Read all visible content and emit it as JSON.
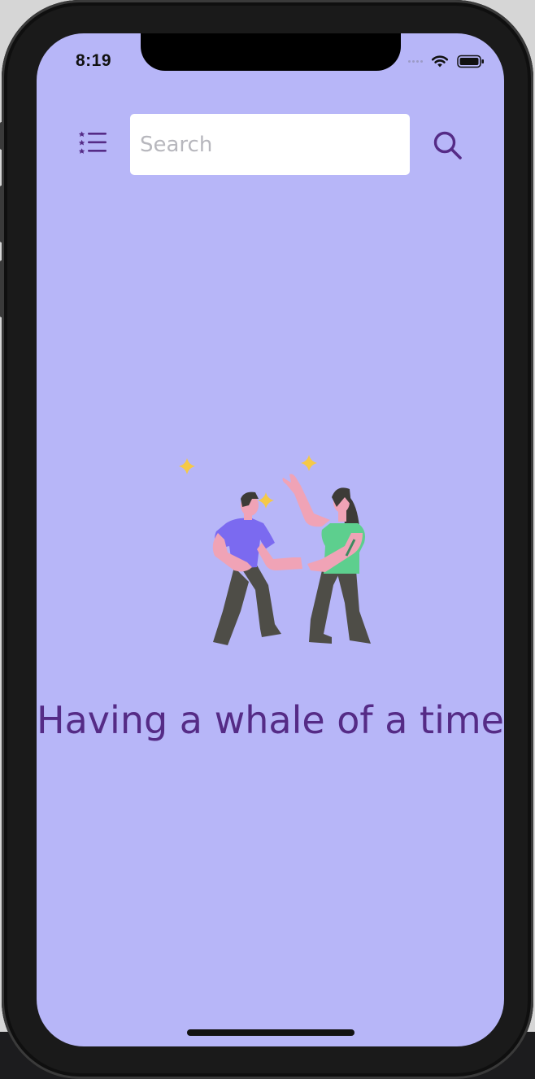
{
  "status_bar": {
    "time": "8:19"
  },
  "header": {
    "menu_icon": "list-star-icon",
    "search": {
      "placeholder": "Search",
      "value": ""
    },
    "search_icon": "magnifier-icon"
  },
  "main": {
    "illustration": "two-people-high-five-illustration",
    "headline": "Having a whale of a time"
  },
  "colors": {
    "background": "#b7b6f8",
    "accent": "#552b86",
    "search_field": "#ffffff"
  }
}
